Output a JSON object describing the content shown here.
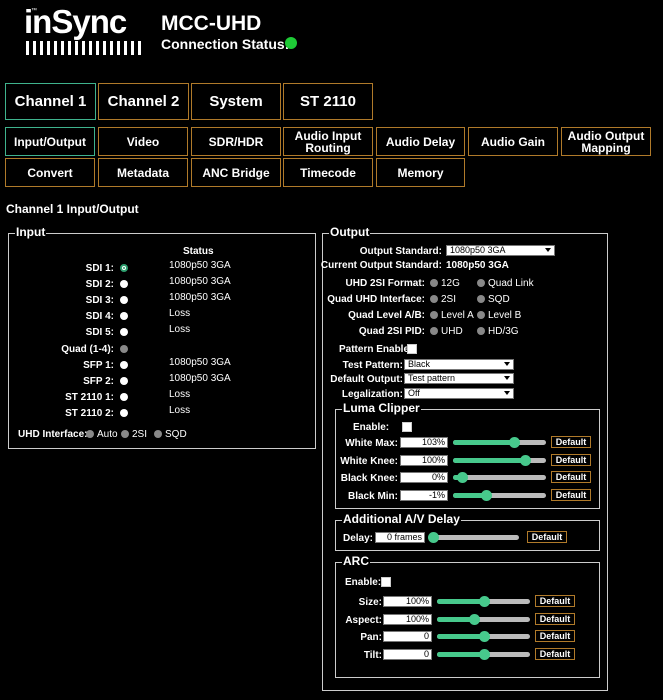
{
  "header": {
    "logo_text": "inSync",
    "logo_tm": "™",
    "device": "MCC-UHD",
    "conn_label": "Connection Status:",
    "conn_color": "#1ecb36"
  },
  "main_tabs": [
    "Channel 1",
    "Channel 2",
    "System",
    "ST 2110"
  ],
  "sub_tabs_row1": [
    "Input/Output",
    "Video",
    "SDR/HDR",
    "Audio Input Routing",
    "Audio Delay",
    "Audio Gain",
    "Audio Output Mapping"
  ],
  "sub_tabs_row2": [
    "Convert",
    "Metadata",
    "ANC Bridge",
    "Timecode",
    "Memory"
  ],
  "page_title": "Channel 1 Input/Output",
  "input": {
    "legend": "Input",
    "status_header": "Status",
    "rows": [
      {
        "label": "SDI 1:",
        "status": "1080p50 3GA"
      },
      {
        "label": "SDI 2:",
        "status": "1080p50 3GA"
      },
      {
        "label": "SDI 3:",
        "status": "1080p50 3GA"
      },
      {
        "label": "SDI 4:",
        "status": "Loss"
      },
      {
        "label": "SDI 5:",
        "status": "Loss"
      },
      {
        "label": "Quad (1-4):",
        "status": ""
      },
      {
        "label": "SFP 1:",
        "status": "1080p50 3GA"
      },
      {
        "label": "SFP 2:",
        "status": "1080p50 3GA"
      },
      {
        "label": "ST 2110 1:",
        "status": "Loss"
      },
      {
        "label": "ST 2110 2:",
        "status": "Loss"
      }
    ],
    "uhd_label": "UHD Interface:",
    "uhd_options": [
      "Auto",
      "2SI",
      "SQD"
    ]
  },
  "output": {
    "legend": "Output",
    "std_label": "Output Standard:",
    "std_value": "1080p50 3GA",
    "cur_label": "Current Output Standard:",
    "cur_value": "1080p50 3GA",
    "fmt_label": "UHD 2SI Format:",
    "fmt_options": [
      "12G",
      "Quad Link"
    ],
    "quad_if_label": "Quad UHD Interface:",
    "quad_if_options": [
      "2SI",
      "SQD"
    ],
    "level_label": "Quad Level A/B:",
    "level_options": [
      "Level A",
      "Level B"
    ],
    "pid_label": "Quad 2SI PID:",
    "pid_options": [
      "UHD",
      "HD/3G"
    ],
    "pattern_enable_label": "Pattern Enable:",
    "test_pattern_label": "Test Pattern:",
    "test_pattern_value": "Black",
    "default_output_label": "Default Output:",
    "default_output_value": "Test pattern",
    "legalization_label": "Legalization:",
    "legalization_value": "Off"
  },
  "luma": {
    "legend": "Luma Clipper",
    "enable_label": "Enable:",
    "rows": [
      {
        "label": "White Max:",
        "value": "103%",
        "level": 0.66
      },
      {
        "label": "White Knee:",
        "value": "100%",
        "level": 0.77
      },
      {
        "label": "Black Knee:",
        "value": "0%",
        "level": 0.1
      },
      {
        "label": "Black Min:",
        "value": "-1%",
        "level": 0.35
      }
    ]
  },
  "av_delay": {
    "legend": "Additional A/V Delay",
    "label": "Delay:",
    "value": "0 frames",
    "level": 0
  },
  "arc": {
    "legend": "ARC",
    "enable_label": "Enable:",
    "rows": [
      {
        "label": "Size:",
        "value": "100%",
        "level": 0.5
      },
      {
        "label": "Aspect:",
        "value": "100%",
        "level": 0.4
      },
      {
        "label": "Pan:",
        "value": "0",
        "level": 0.5
      },
      {
        "label": "Tilt:",
        "value": "0",
        "level": 0.5
      }
    ]
  },
  "default_label": "Default"
}
